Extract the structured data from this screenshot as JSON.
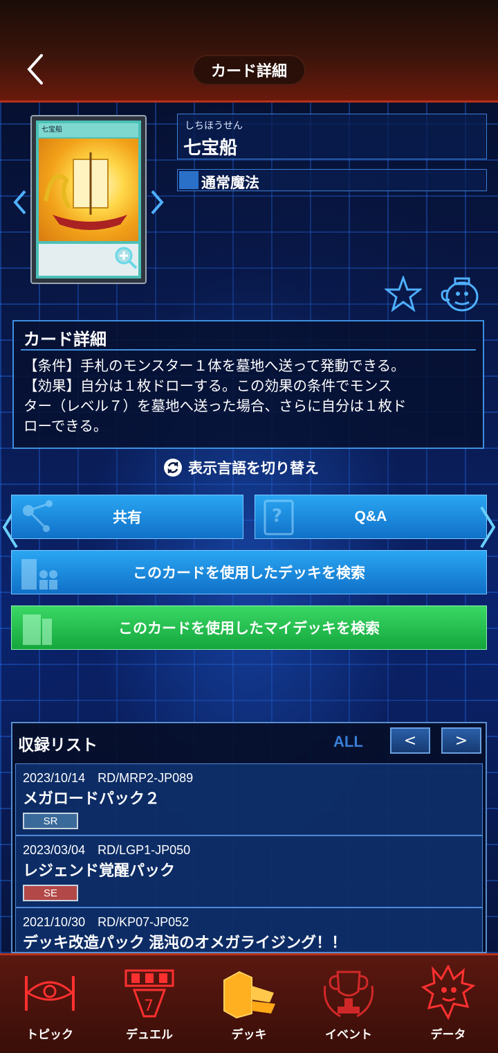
{
  "header": {
    "title": "カード詳細"
  },
  "card": {
    "ruby": "しちほうせん",
    "name": "七宝船",
    "type": "通常魔法",
    "image_title": "七宝船"
  },
  "detail": {
    "title": "カード詳細",
    "text": "【条件】手札のモンスター１体を墓地へ送って発動できる。\n【効果】自分は１枚ドローする。この効果の条件でモンス\nター（レベル７）を墓地へ送った場合、さらに自分は１枚ド\nローできる。"
  },
  "language_switch": "表示言語を切り替え",
  "buttons": {
    "share": "共有",
    "qa": "Q&A",
    "search_decks": "このカードを使用したデッキを検索",
    "search_my_decks": "このカードを使用したマイデッキを検索"
  },
  "release_list": {
    "title": "収録リスト",
    "filter": "ALL",
    "prev": "<",
    "next": ">",
    "rows": [
      {
        "meta": "2023/10/14　RD/MRP2-JP089",
        "name": "メガロードパック２",
        "rarity": "SR",
        "rarity_color": "#3a6a9a"
      },
      {
        "meta": "2023/03/04　RD/LGP1-JP050",
        "name": "レジェンド覚醒パック",
        "rarity": "SE",
        "rarity_color": "#b34848"
      },
      {
        "meta": "2021/10/30　RD/KP07-JP052",
        "name": "デッキ改造パック 混沌のオメガライジング！！",
        "rarity": "",
        "rarity_color": ""
      }
    ]
  },
  "nav": [
    {
      "label": "トピック",
      "icon": "topic-ship-icon",
      "active": false
    },
    {
      "label": "デュエル",
      "icon": "duel-cards-icon",
      "active": false
    },
    {
      "label": "デッキ",
      "icon": "deck-icon",
      "active": true
    },
    {
      "label": "イベント",
      "icon": "trophy-icon",
      "active": false
    },
    {
      "label": "データ",
      "icon": "data-character-icon",
      "active": false
    }
  ],
  "colors": {
    "accent_red": "#b8321a",
    "accent_blue": "#1070c8",
    "accent_green": "#14a63c",
    "active_nav": "#ffbf2a"
  }
}
